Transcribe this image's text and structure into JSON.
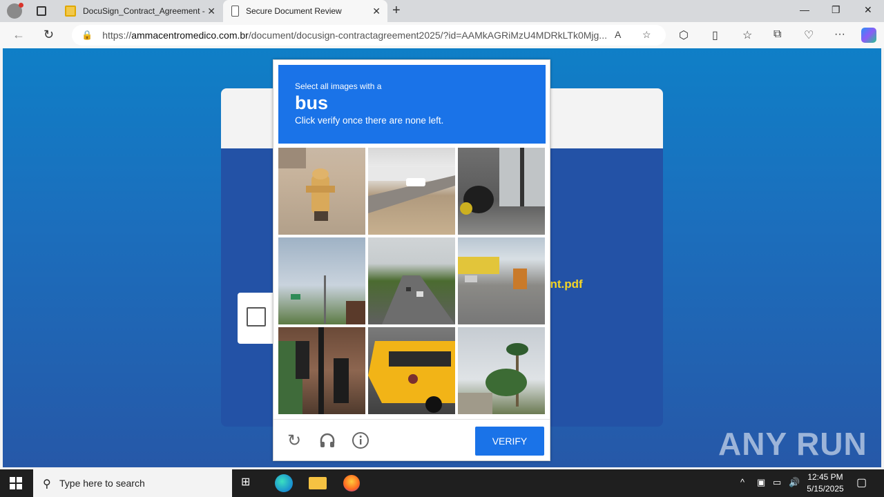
{
  "browser": {
    "tabs": [
      {
        "title": "DocuSign_Contract_Agreement -"
      },
      {
        "title": "Secure Document Review"
      }
    ],
    "url_domain": "ammacentromedico.com.br",
    "url_prefix": "https://",
    "url_path": "/document/docusign-contractagreement2025/?id=AAMkAGRiMzU4MDRkLTk0Mjg..."
  },
  "page": {
    "filename_fragment": "ent.pdf",
    "watermark": "ANY RUN"
  },
  "captcha": {
    "instruction": "Select all images with a",
    "target": "bus",
    "hint": "Click verify once there are none left.",
    "verify_label": "VERIFY",
    "tiles": [
      "fire hydrant",
      "road with car",
      "scooter",
      "traffic signal",
      "highway",
      "street",
      "traffic lights",
      "school bus",
      "palm trees"
    ]
  },
  "taskbar": {
    "search_placeholder": "Type here to search",
    "time": "12:45 PM",
    "date": "5/15/2025"
  }
}
